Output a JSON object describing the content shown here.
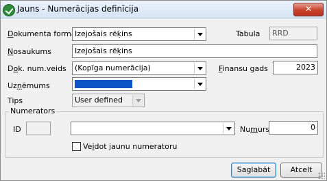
{
  "window": {
    "title": "Jauns - Numerācijas definīcija",
    "close_label": "✕"
  },
  "form": {
    "dokumenta_forma": {
      "label_ul": "D",
      "label_rest": "okumenta forma",
      "value": "Izejošais rēķins"
    },
    "tabula": {
      "label": "Tabula",
      "value": "RRD"
    },
    "nosaukums": {
      "label_ul": "N",
      "label_rest": "osaukums",
      "value": "Izejošais rēķins"
    },
    "dok_num_veids": {
      "label_pre": "D",
      "label_ul": "o",
      "label_rest": "k. num.veids",
      "value": "(Kopīga numerācija)"
    },
    "finansu_gads": {
      "label_ul": "F",
      "label_rest": "inansu gads",
      "value": "2023"
    },
    "uznemums": {
      "label_pre": "Uz",
      "label_ul": "ņ",
      "label_rest": "ēmums",
      "value": ""
    },
    "tips": {
      "label": "Tips",
      "value": "User defined"
    }
  },
  "numerators": {
    "group_label": "Numerators",
    "id_label": "ID",
    "id_value": "",
    "combo_value": "",
    "numurs": {
      "label_pre": "Nu",
      "label_ul": "m",
      "label_rest": "urs",
      "value": "0"
    },
    "checkbox": {
      "label_pre": "Ve",
      "label_ul": "i",
      "label_rest": "dot jaunu numeratoru",
      "checked": false
    }
  },
  "buttons": {
    "save": "Saglabāt",
    "cancel": "Atcelt"
  }
}
